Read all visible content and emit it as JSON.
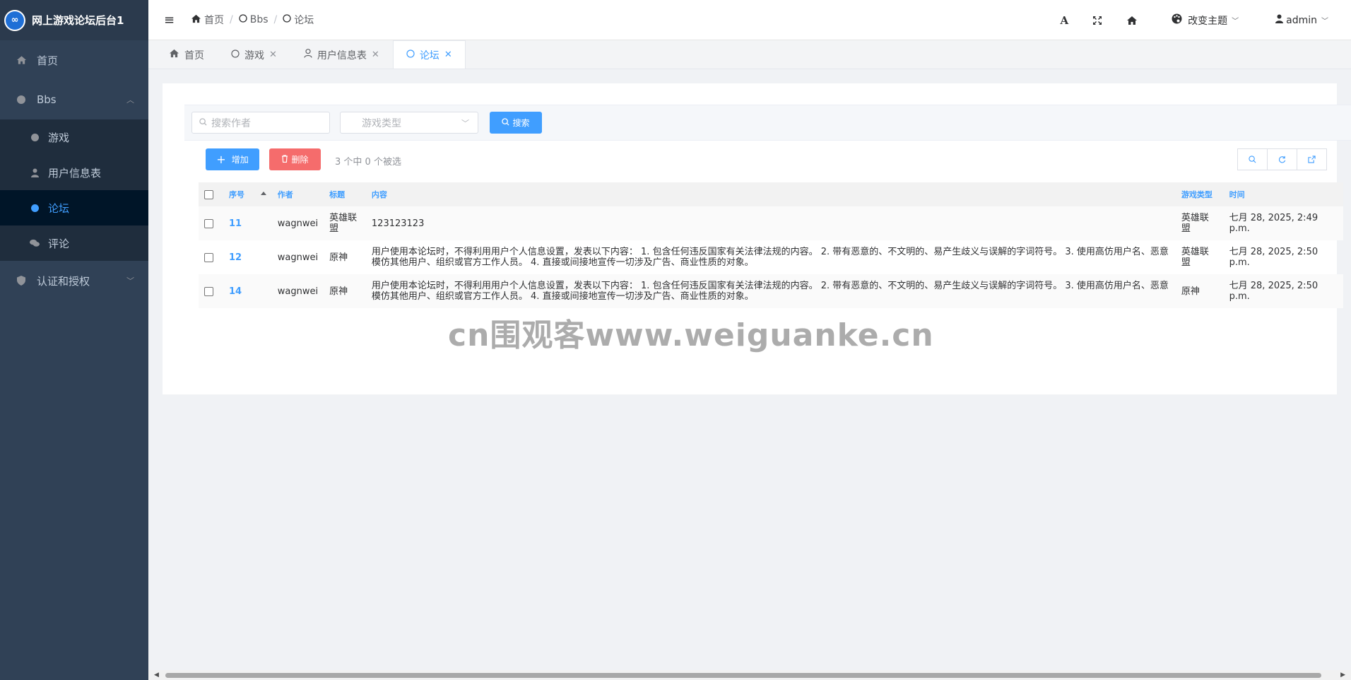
{
  "app": {
    "title": "网上游戏论坛后台1",
    "logo_text": "∞"
  },
  "sidebar": {
    "home": "首页",
    "bbs": "Bbs",
    "sub": [
      {
        "label": "游戏"
      },
      {
        "label": "用户信息表"
      },
      {
        "label": "论坛"
      },
      {
        "label": "评论"
      }
    ],
    "auth": "认证和授权"
  },
  "breadcrumb": [
    "首页",
    "Bbs",
    "论坛"
  ],
  "header": {
    "theme": "改变主题",
    "user": "admin"
  },
  "tabs": [
    {
      "label": "首页"
    },
    {
      "label": "游戏"
    },
    {
      "label": "用户信息表"
    },
    {
      "label": "论坛"
    }
  ],
  "search": {
    "author_placeholder": "搜索作者",
    "type_placeholder": "游戏类型",
    "button": "搜索"
  },
  "actions": {
    "add": "增加",
    "delete": "删除",
    "selection": "3 个中 0 个被选"
  },
  "table": {
    "headers": {
      "id": "序号",
      "author": "作者",
      "title": "标题",
      "content": "内容",
      "type": "游戏类型",
      "time": "时间"
    },
    "rows": [
      {
        "id": "11",
        "author": "wagnwei",
        "title": "英雄联盟",
        "content": "123123123",
        "type": "英雄联盟",
        "time": "七月 28, 2025, 2:49 p.m."
      },
      {
        "id": "12",
        "author": "wagnwei",
        "title": "原神",
        "content": "用户使用本论坛时，不得利用用户个人信息设置，发表以下内容： 1. 包含任何违反国家有关法律法规的内容。 2. 带有恶意的、不文明的、易产生歧义与误解的字词符号。 3. 使用高仿用户名、恶意模仿其他用户、组织或官方工作人员。 4. 直接或间接地宣传一切涉及广告、商业性质的对象。",
        "type": "英雄联盟",
        "time": "七月 28, 2025, 2:50 p.m."
      },
      {
        "id": "14",
        "author": "wagnwei",
        "title": "原神",
        "content": "用户使用本论坛时，不得利用用户个人信息设置，发表以下内容： 1. 包含任何违反国家有关法律法规的内容。 2. 带有恶意的、不文明的、易产生歧义与误解的字词符号。 3. 使用高仿用户名、恶意模仿其他用户、组织或官方工作人员。 4. 直接或间接地宣传一切涉及广告、商业性质的对象。",
        "type": "原神",
        "time": "七月 28, 2025, 2:50 p.m."
      }
    ]
  },
  "watermark": "cn围观客www.weiguanke.cn",
  "colors": {
    "sidebar_bg": "#304156",
    "accent": "#409eff",
    "danger": "#f56c6c"
  }
}
